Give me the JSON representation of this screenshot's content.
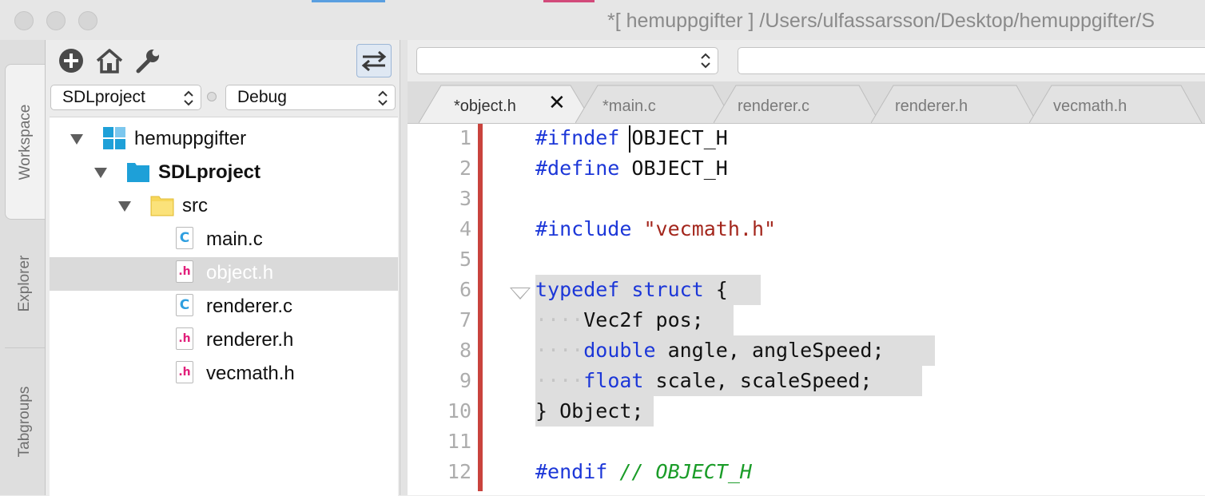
{
  "window": {
    "title": "*[ hemuppgifter ] /Users/ulfassarsson/Desktop/hemuppgifter/S"
  },
  "sidebar_tabs": [
    "Workspace",
    "Explorer",
    "Tabgroups"
  ],
  "toolbar": {
    "icons": [
      "add-icon",
      "home-icon",
      "wrench-icon",
      "swap-icon"
    ]
  },
  "project_select": {
    "value": "SDLproject"
  },
  "config_select": {
    "value": "Debug"
  },
  "tree": {
    "workspace": "hemuppgifter",
    "project": "SDLproject",
    "folder": "src",
    "files": [
      {
        "name": "main.c",
        "type": "C"
      },
      {
        "name": "object.h",
        "type": ".h",
        "selected": true
      },
      {
        "name": "renderer.c",
        "type": "C"
      },
      {
        "name": "renderer.h",
        "type": ".h"
      },
      {
        "name": "vecmath.h",
        "type": ".h"
      }
    ]
  },
  "editor_tabs": [
    {
      "label": "*object.h",
      "active": true,
      "close": "✕"
    },
    {
      "label": "*main.c"
    },
    {
      "label": "renderer.c"
    },
    {
      "label": "renderer.h"
    },
    {
      "label": "vecmath.h"
    }
  ],
  "code": {
    "line_numbers": [
      "1",
      "2",
      "3",
      "4",
      "5",
      "6",
      "7",
      "8",
      "9",
      "10",
      "11",
      "12"
    ],
    "lines": [
      {
        "kw": "#ifndef",
        "rest": " OBJECT_H"
      },
      {
        "kw": "#define",
        "rest": " OBJECT_H"
      },
      {
        "text": ""
      },
      {
        "kw": "#include",
        "rest": " ",
        "str": "\"vecmath.h\""
      },
      {
        "text": ""
      },
      {
        "kw": "typedef",
        "rest": " ",
        "kw2": "struct",
        "rest2": " {"
      },
      {
        "indent": "····",
        "text": "Vec2f pos;"
      },
      {
        "indent": "····",
        "kw": "double",
        "rest": " angle, angleSpeed;"
      },
      {
        "indent": "····",
        "kw": "float",
        "rest": " scale, scaleSpeed;"
      },
      {
        "text": "} Object;"
      },
      {
        "text": ""
      },
      {
        "kw": "#endif",
        "rest": " ",
        "com": "// OBJECT_H"
      }
    ]
  },
  "colors": {
    "keyword": "#1c37d8",
    "string": "#a3261c",
    "comment": "#1a9c28",
    "modified_bar": "#c9433d",
    "line_highlight": "#dedede",
    "c_icon": "#2f9fe0",
    "h_icon": "#e1207b",
    "folder_project": "#1ea0d8",
    "folder_src": "#f7d75a"
  }
}
